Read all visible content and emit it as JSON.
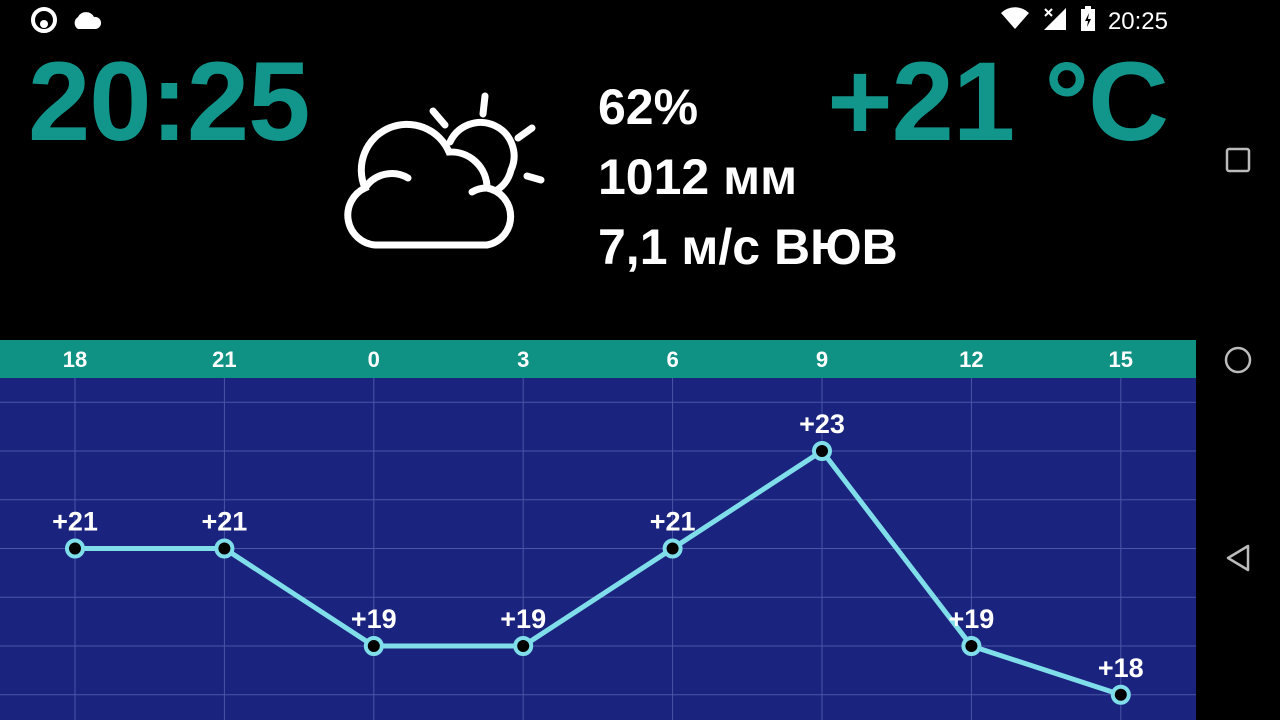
{
  "status_bar": {
    "left_icons": [
      "notification-ring-icon",
      "cloud-icon"
    ],
    "right_icons": [
      "wifi-icon",
      "signal-icon",
      "battery-icon"
    ],
    "time": "20:25"
  },
  "main": {
    "clock": "20:25",
    "temperature": "+21 °C",
    "condition_icon": "partly-cloudy-icon",
    "humidity": "62%",
    "pressure": "1012 мм",
    "wind": "7,1 м/с ВЮВ"
  },
  "nav": {
    "icons": [
      "recents-icon",
      "home-icon",
      "back-icon"
    ]
  },
  "colors": {
    "accent": "#12968c",
    "header_bar": "#0f9283",
    "chart_bg": "#1a237e",
    "line": "#80deea"
  },
  "chart_data": {
    "type": "line",
    "categories": [
      "18",
      "21",
      "0",
      "3",
      "6",
      "9",
      "12",
      "15"
    ],
    "values": [
      21,
      21,
      19,
      19,
      21,
      23,
      19,
      18
    ],
    "labels": [
      "+21",
      "+21",
      "+19",
      "+19",
      "+21",
      "+23",
      "+19",
      "+18"
    ],
    "grid": true
  }
}
